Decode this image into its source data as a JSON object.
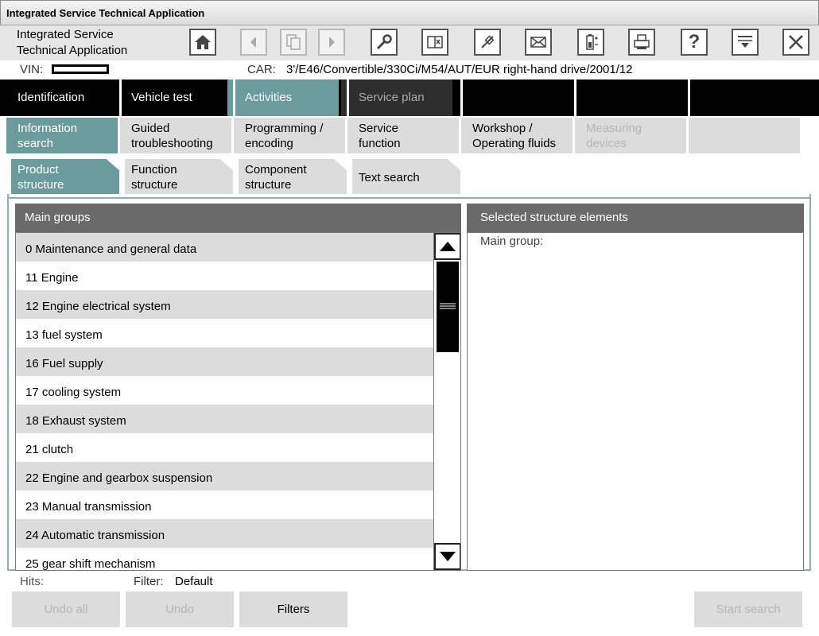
{
  "window": {
    "title": "Integrated Service Technical Application"
  },
  "app": {
    "title_line1": "Integrated Service",
    "title_line2": "Technical Application"
  },
  "toolbar": {
    "icons": [
      "home-icon",
      "back-icon",
      "copy-icon",
      "forward-icon",
      "wrench-icon",
      "book-icon",
      "connector-icon",
      "mail-icon",
      "battery-icon",
      "printer-icon",
      "help-icon",
      "menu-down-icon",
      "close-icon"
    ],
    "help_label": "?"
  },
  "vehicle": {
    "vin_label": "VIN:",
    "car_label": "CAR:",
    "car_value": "3'/E46/Convertible/330Ci/M54/AUT/EUR right-hand drive/2001/12"
  },
  "nav1": {
    "items": [
      {
        "label": "Identification"
      },
      {
        "label": "Vehicle test"
      },
      {
        "label": "Activities"
      },
      {
        "label": "Service plan"
      }
    ]
  },
  "nav2": {
    "items": [
      {
        "line1": "Information",
        "line2": "search"
      },
      {
        "line1": "Guided",
        "line2": "troubleshooting"
      },
      {
        "line1": "Programming /",
        "line2": "encoding"
      },
      {
        "line1": "Service",
        "line2": "function"
      },
      {
        "line1": "Workshop /",
        "line2": "Operating fluids"
      },
      {
        "line1": "Measuring",
        "line2": "devices"
      }
    ]
  },
  "tabs": {
    "items": [
      {
        "line1": "Product",
        "line2": "structure"
      },
      {
        "line1": "Function",
        "line2": "structure"
      },
      {
        "line1": "Component",
        "line2": "structure"
      },
      {
        "line1": "Text search",
        "line2": ""
      }
    ]
  },
  "main_groups": {
    "header": "Main groups",
    "items": [
      "0 Maintenance and general data",
      "11 Engine",
      "12 Engine electrical system",
      "13 fuel system",
      "16 Fuel supply",
      "17 cooling system",
      "18 Exhaust system",
      "21 clutch",
      "22 Engine and gearbox suspension",
      "23 Manual transmission",
      "24 Automatic transmission",
      "25 gear shift mechanism"
    ]
  },
  "selected": {
    "header": "Selected structure elements",
    "main_group_label": "Main group:"
  },
  "footer": {
    "hits_label": "Hits:",
    "filter_label": "Filter:",
    "filter_value": "Default",
    "undo_all": "Undo all",
    "undo": "Undo",
    "filters": "Filters",
    "start_search": "Start search"
  },
  "colors": {
    "accent": "#6b9b9c",
    "nav_black": "#000000",
    "gray_fill": "#dcdcdc",
    "panel_header": "#6a6a6a"
  }
}
